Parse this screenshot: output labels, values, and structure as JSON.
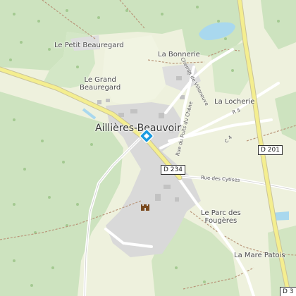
{
  "map": {
    "places": {
      "le_petit_beauregard": "Le Petit Beauregard",
      "la_bonnerie": "La Bonnerie",
      "le_grand_beauregard": [
        "Le Grand",
        "Beauregard"
      ],
      "la_locherie": "La Locherie",
      "town": "Aillières-Beauvoir",
      "le_parc_des_fougeres": [
        "Le Parc des",
        "Fougères"
      ],
      "la_mare_patois": "La Mare Patois"
    },
    "roads": {
      "chemin_de_villeneuve": "Chemin de Villeneuve",
      "rue_du_puits_du_chene": "Rue du Puits du Chêne",
      "r5": "R 5",
      "c4": "C 4",
      "rue_des_cytises": "Rue des Cytises"
    },
    "shields": {
      "d201": "D 201",
      "d234": "D 234",
      "d3": "D 3"
    },
    "markers": {
      "poi_marker": "location-diamond-icon",
      "castle": "castle-icon"
    },
    "colors": {
      "forest": "#cde3bf",
      "open_land": "#eef1dd",
      "urban": "#d9d9d9",
      "water": "#a9d8ee",
      "main_road": "#f4ee8f",
      "marker": "#1a9be0"
    }
  }
}
